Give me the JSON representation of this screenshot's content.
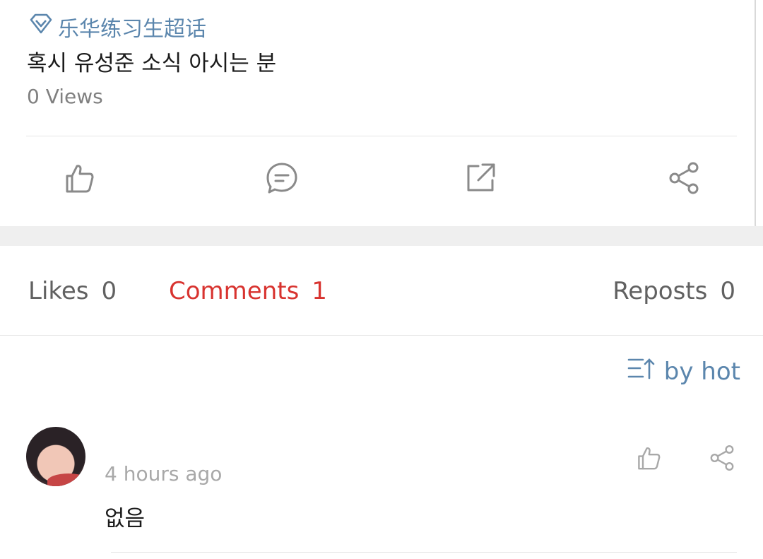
{
  "post": {
    "topic": "乐华练习生超话",
    "text": "혹시 유성준 소식 아시는 분",
    "views": "0 Views",
    "actions": {
      "like_icon": "thumbs-up-icon",
      "comment_icon": "comment-icon",
      "repost_icon": "repost-icon",
      "share_icon": "share-icon"
    }
  },
  "tabs": [
    {
      "label": "Likes",
      "count": "0"
    },
    {
      "label": "Comments",
      "count": "1"
    },
    {
      "label": "Reposts",
      "count": "0"
    }
  ],
  "sort": {
    "label": "by hot",
    "icon": "sort-icon"
  },
  "comments": [
    {
      "time": "4 hours ago",
      "text": "없음",
      "avatar": "user-avatar"
    }
  ],
  "colors": {
    "accent_blue": "#5b86ad",
    "active_red": "#d8332f",
    "text_dark": "#1b1b1b",
    "text_grey": "#808080"
  }
}
